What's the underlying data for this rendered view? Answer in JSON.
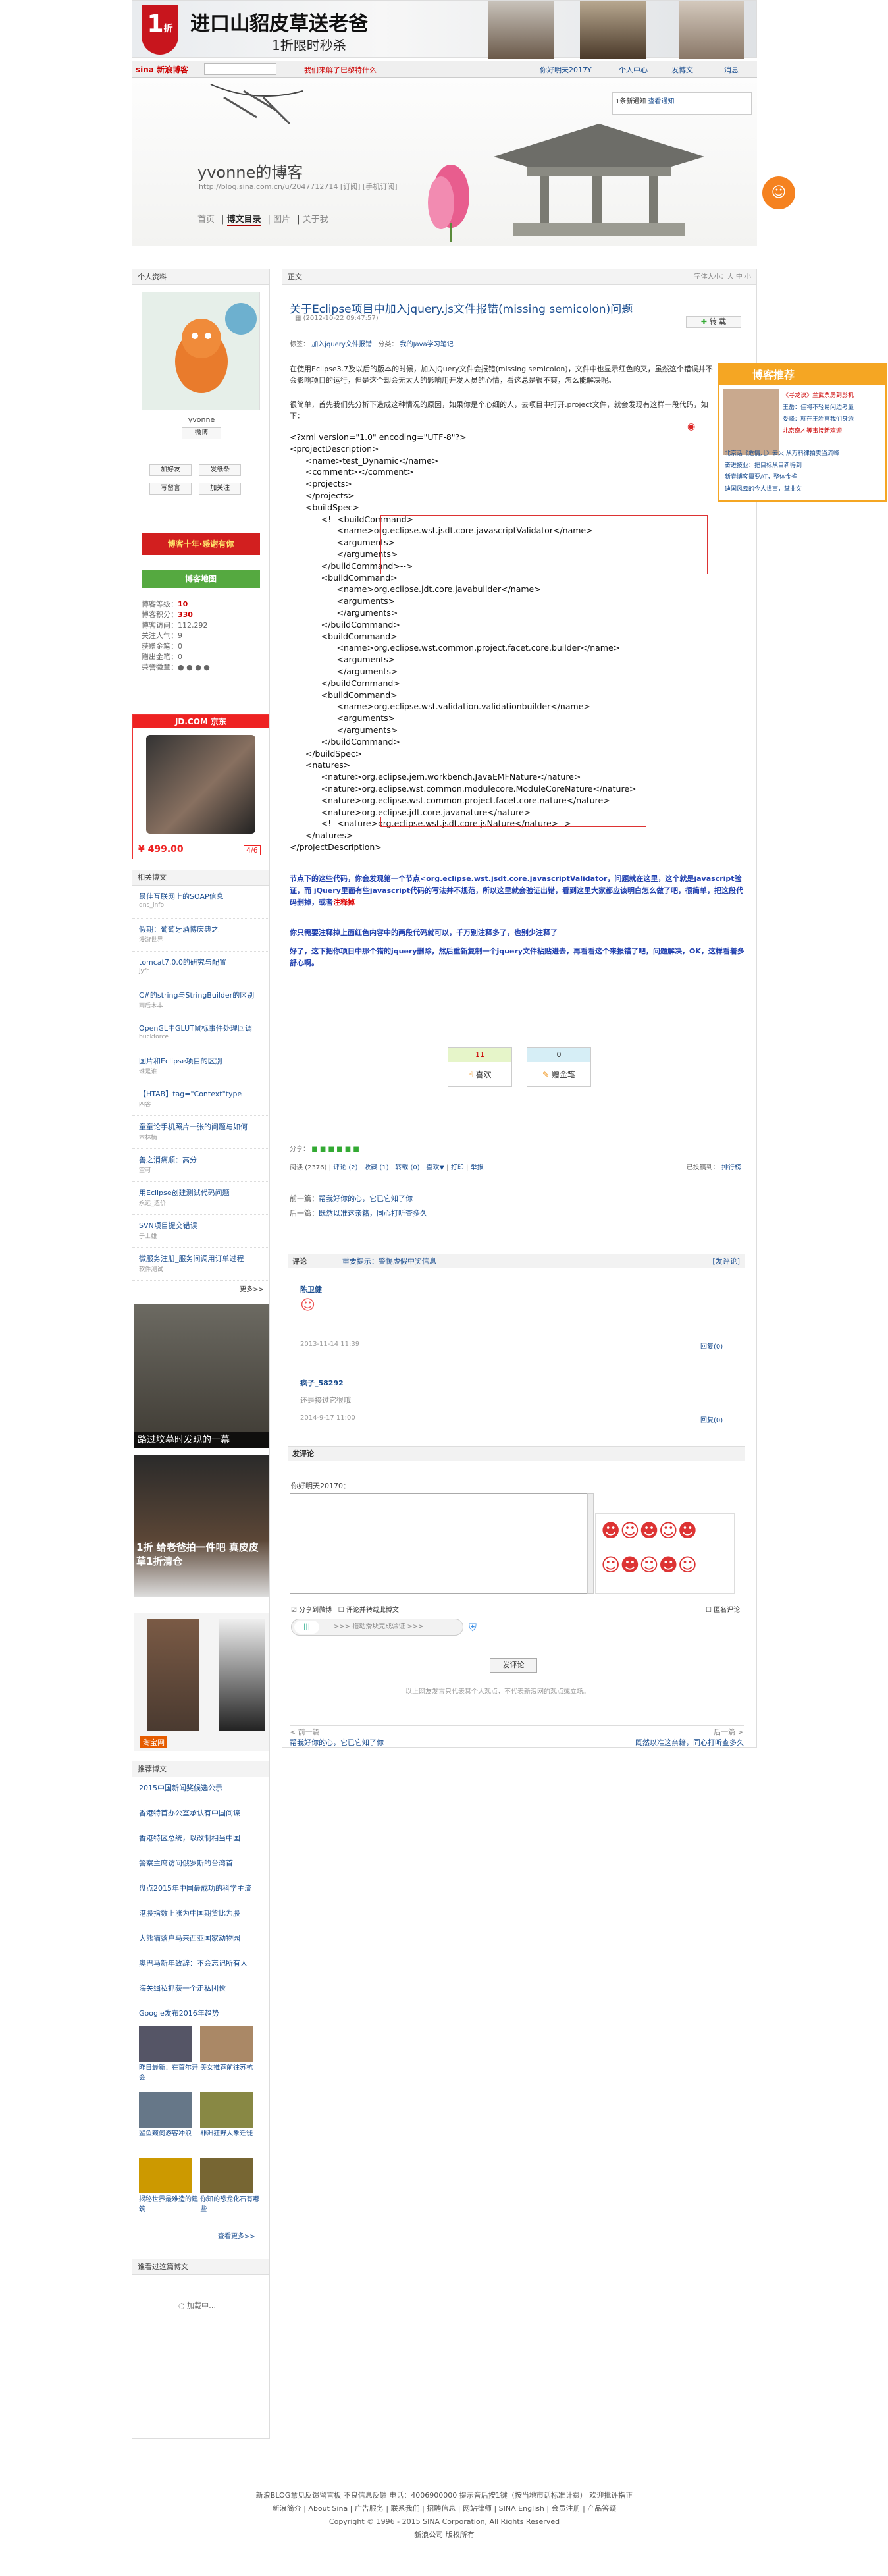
{
  "ad_top": {
    "badge_num": "1",
    "badge_unit": "折",
    "headline": "进口山貂皮草送老爸",
    "subline": "1折限时秒杀"
  },
  "topnav": {
    "logo": "sina 新浪博客",
    "promo": "我们来解了巴黎特什么",
    "items": [
      "你好明天2017Y",
      "个人中心",
      "发博文",
      "消息"
    ]
  },
  "notice": {
    "text": "1条新通知",
    "link": "查看通知"
  },
  "blog": {
    "title": "yvonne的博客",
    "url": "http://blog.sina.com.cn/u/2047712714 [订阅] [手机订阅]",
    "nav": [
      "首页",
      "博文目录",
      "图片",
      "关于我"
    ],
    "nav_active": 1
  },
  "profile": {
    "panel_title": "个人资料",
    "name": "yvonne",
    "weibo": "微博",
    "btns": [
      "加好友",
      "发纸条",
      "写留言",
      "加关注"
    ],
    "badge1": "博客十年·感谢有你",
    "badge2": "博客地图",
    "stats": [
      {
        "label": "博客等级：",
        "value": "10"
      },
      {
        "label": "博客积分：",
        "value": "330"
      },
      {
        "label": "博客访问：",
        "value": "112,292"
      },
      {
        "label": "关注人气：",
        "value": "9"
      },
      {
        "label": "获赠金笔：",
        "value": "0"
      },
      {
        "label": "赠出金笔：",
        "value": "0"
      },
      {
        "label": "荣誉徽章：",
        "value": ""
      }
    ]
  },
  "jd_ad": {
    "logo": "JD.COM 京东",
    "price": "¥ 499.00",
    "page": "4/6"
  },
  "related": {
    "title": "相关博文",
    "items": [
      {
        "title": "最佳互联网上的SOAP信息",
        "by": "dns_info"
      },
      {
        "title": "假期：葡萄牙酒博庆典之",
        "by": "漫游世界"
      },
      {
        "title": "tomcat7.0.0的研究与配置",
        "by": "jyfr"
      },
      {
        "title": "C#的string与StringBuilder的区别",
        "by": "雨后木本"
      },
      {
        "title": "OpenGL中GLUT鼠标事件处理回调",
        "by": "buckforce"
      },
      {
        "title": "图片和Eclipse项目的区别",
        "by": "谁是谁"
      },
      {
        "title": "【HTAB】tag=\"Context\"type",
        "by": "四谷"
      },
      {
        "title": "童童论手机照片一张的问题与如何",
        "by": "木林楠"
      },
      {
        "title": "善之消痛顺：高分",
        "by": "空可"
      },
      {
        "title": "用Eclipse创建测试代码问题",
        "by": "永远_造价"
      },
      {
        "title": "SVN项目提交错误",
        "by": "于士雄"
      },
      {
        "title": "微服务注册_服务间调用订单过程",
        "by": "软件测试"
      }
    ],
    "more": "更多>>"
  },
  "img_ads": [
    {
      "caption": "路过坟墓时发现的一幕"
    },
    {
      "caption": "1折 给老爸拍一件吧 真皮皮草1折清仓"
    },
    {
      "caption": "淘宝网"
    }
  ],
  "recommend": {
    "title": "推荐博文",
    "items": [
      "2015中国新闻奖候选公示",
      "香港特首办公室承认有中国间谍",
      "香港特区总统，以改制相当中国",
      "警察主席访问俄罗斯的台湾首",
      "盘点2015年中国最成功的科学主流",
      "港股指数上涨为中国期货比为股",
      "大熊猫落户马来西亚国家动物园",
      "奥巴马新年致辞：不会忘记所有人",
      "海关缉私抓获一个走私团伙",
      "Google发布2016年趋势"
    ],
    "thumbs": [
      "昨日最新：在首尔开会",
      "美女推荐前往苏杭",
      "鲨鱼窥伺游客冲浪",
      "非洲狂野大象迁徙",
      "揭秘世界最难造的建筑",
      "你知的恐龙化石有哪些"
    ],
    "more": "查看更多>>"
  },
  "visitors": {
    "title": "谁看过这篇博文",
    "loading": "加载中…"
  },
  "article": {
    "tab": "正文",
    "font": "字体大小：大 中 小",
    "title": "关于Eclipse项目中加入jquery.js文件报错(missing semicolon)问题",
    "date": "(2012-10-22 09:47:57)",
    "share": "转 载",
    "tags_label": "标签：",
    "tag": "加入jquery文件报错",
    "cat_label": "分类：",
    "category": "我的Java学习笔记",
    "intro": "在使用Eclipse3.7及以后的版本的时候，加入jQuery文件会报错(missing semicolon)，文件中也显示红色的叉，虽然这个错误并不会影响项目的运行，但是这个却会无太大的影响用开发人员的心情，看这总是很不爽，怎么能解决呢。",
    "intro2": "很简单，首先我们先分析下造成这种情况的原因，如果你是个心细的人，去项目中打开.project文件，就会发现有这样一段代码，如下："
  },
  "code_lines": [
    "<?xml version=\"1.0\" encoding=\"UTF-8\"?>",
    "<projectDescription>",
    "      <name>test_Dynamic</name>",
    "      <comment></comment>",
    "      <projects>",
    "      </projects>",
    "      <buildSpec>",
    "            <!--<buildCommand>",
    "                  <name>org.eclipse.wst.jsdt.core.javascriptValidator</name>",
    "                  <arguments>",
    "                  </arguments>",
    "            </buildCommand>-->",
    "            <buildCommand>",
    "                  <name>org.eclipse.jdt.core.javabuilder</name>",
    "                  <arguments>",
    "                  </arguments>",
    "            </buildCommand>",
    "            <buildCommand>",
    "                  <name>org.eclipse.wst.common.project.facet.core.builder</name>",
    "                  <arguments>",
    "                  </arguments>",
    "            </buildCommand>",
    "            <buildCommand>",
    "                  <name>org.eclipse.wst.validation.validationbuilder</name>",
    "                  <arguments>",
    "                  </arguments>",
    "            </buildCommand>",
    "      </buildSpec>",
    "      <natures>",
    "            <nature>org.eclipse.jem.workbench.JavaEMFNature</nature>",
    "            <nature>org.eclipse.wst.common.modulecore.ModuleCoreNature</nature>",
    "            <nature>org.eclipse.wst.common.project.facet.core.nature</nature>",
    "            <nature>org.eclipse.jdt.core.javanature</nature>",
    "            <!--<nature>org.eclipse.wst.jsdt.core.jsNature</nature>-->",
    "      </natures>",
    "</projectDescription>"
  ],
  "para1": "节点下的这些代码，你会发现第一个节点<org.eclipse.wst.jsdt.core.javascriptValidator，问题就在这里，这个就是javascript验证，而 jQuery里面有些javascript代码的写法并不规范，所以这里就会验证出错，看到这里大家都应该明白怎么做了吧，很简单，把这段代码删掉，或者",
  "para1_red": "注释掉",
  "para2": "你只需要注释掉上面红色内容中的两段代码就可以，千万别注释多了，也别少注释了",
  "para3": "好了，这下把你项目中那个错的jquery删除，然后重新复制一个jquery文件粘贴进去，再看看这个来报错了吧，问题解决，OK，这样看着多舒心啊。",
  "vote": [
    {
      "count": "11",
      "label": "喜欢"
    },
    {
      "count": "0",
      "label": "赠金笔"
    }
  ],
  "meta": {
    "share": "分享：",
    "read": "阅读 (2376)",
    "comment": "评论 (2)",
    "fav": "收藏 (1)",
    "repost": "转载 (0)",
    "like": "喜欢▼",
    "print": "打印",
    "report": "举报",
    "published": "已投稿到：",
    "rank": "排行榜"
  },
  "prev": {
    "label": "前一篇：",
    "title": "帮我好你的心，它已它知了你"
  },
  "next": {
    "label": "后一篇：",
    "title": "既然以准这亲籍，同心打听查多久"
  },
  "comments_bar": {
    "title": "评论",
    "tip": "重要提示：警惕虚假中奖信息",
    "action": "[发评论]"
  },
  "comments": [
    {
      "author": "陈卫健",
      "time": "2013-11-14 11:39",
      "action": "回复(0)"
    },
    {
      "author": "疯子_58292",
      "body": "还是接过它很哦",
      "time": "2014-9-17 11:00",
      "action": "回复(0)"
    }
  ],
  "post": {
    "title": "发评论",
    "user": "你好明天20170：",
    "opt1": "分享到微博",
    "opt2": "评论并转载此博文",
    "anon": "匿名评论",
    "captcha": ">>> 拖动滑块完成验证 >>>",
    "submit": "发评论",
    "disclaimer": "以上网友发言只代表其个人观点，不代表新浪网的观点或立场。"
  },
  "prevnext_bottom": {
    "prev_label": "< 前一篇",
    "prev": "帮我好你的心，它已它知了你",
    "next_label": "后一篇 >",
    "next": "既然以准这亲籍，同心打听查多久"
  },
  "promo_ad": {
    "title": "博客推荐",
    "items": [
      "《寻龙诀》兰武票房到影机",
      "王岳：佳将不轻易闪边考量",
      "娄峰：就在王岩喜我们身边",
      "北京奇才等事接新欢迎",
      "北京话《危情儿》去火 从万科律拍卖当流峰",
      "奋进技业：把目标从目新得到",
      "新春博客摄要AT，整体金雀",
      "迪国风云的今人世事，掌业文"
    ]
  },
  "footer": {
    "line1": "新浪BLOG意见反馈留言板  不良信息反馈  电话：4006900000 提示音后按1键（按当地市话标准计费）  欢迎批评指正",
    "line2": "新浪简介 | About Sina | 广告服务 | 联系我们 | 招聘信息 | 网站律师 | SINA English | 会员注册 | 产品答疑",
    "line3": "Copyright © 1996 - 2015 SINA Corporation, All Rights Reserved",
    "line4": "新浪公司 版权所有"
  }
}
